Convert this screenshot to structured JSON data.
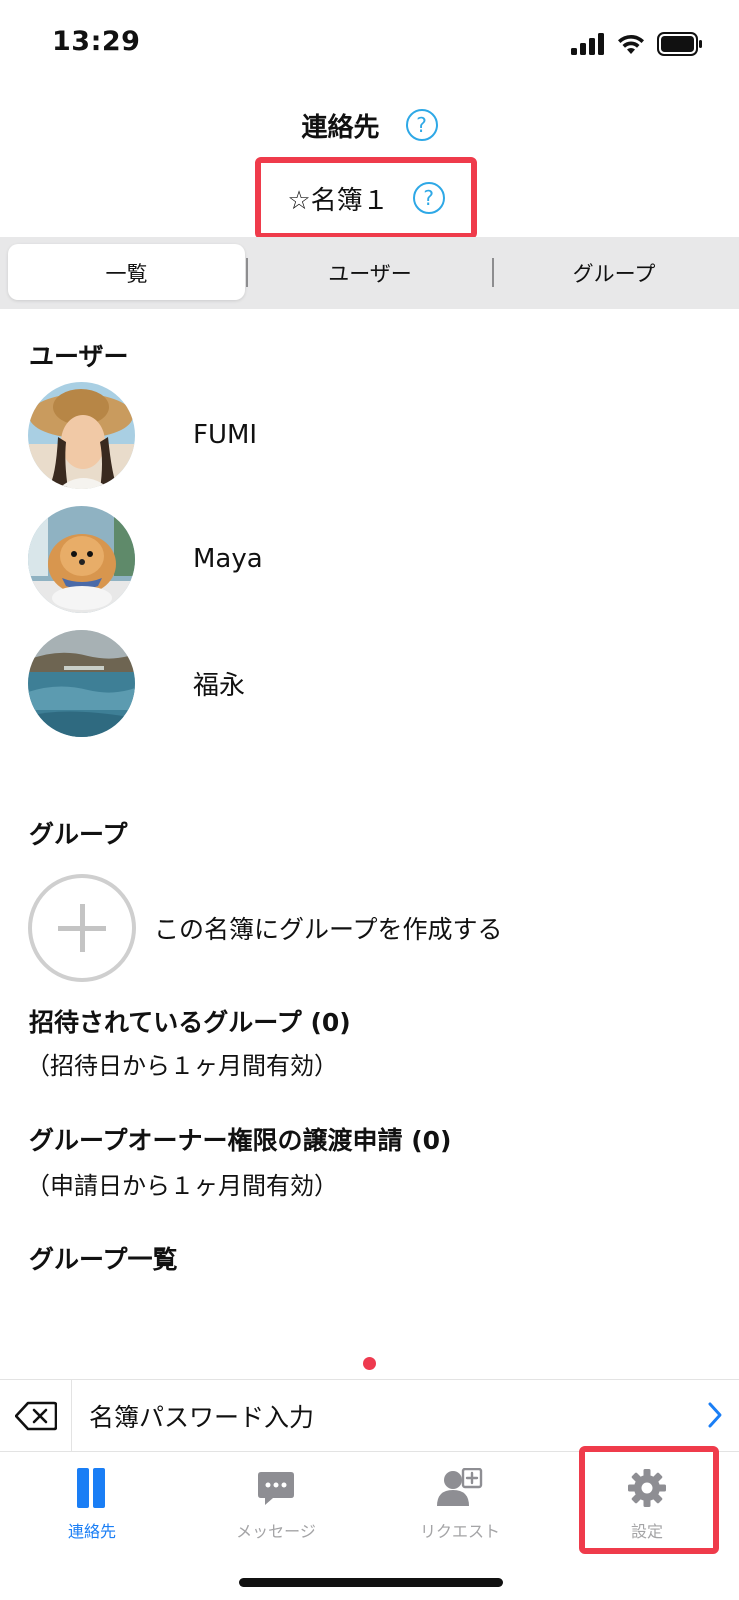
{
  "status_bar": {
    "time": "13:29"
  },
  "header": {
    "title": "連絡先"
  },
  "address_book": {
    "name": "☆名簿１"
  },
  "segments": [
    {
      "label": "一覧",
      "selected": true
    },
    {
      "label": "ユーザー",
      "selected": false
    },
    {
      "label": "グループ",
      "selected": false
    }
  ],
  "users_section": {
    "title": "ユーザー",
    "users": [
      {
        "name": "FUMI"
      },
      {
        "name": "Maya"
      },
      {
        "name": "福永"
      }
    ]
  },
  "groups_section": {
    "title": "グループ",
    "create_label": "この名簿にグループを作成する",
    "invited_title": "招待されているグループ (0)",
    "invited_note": "（招待日から１ヶ月間有効）",
    "transfer_title": "グループオーナー権限の譲渡申請 (0)",
    "transfer_note": "（申請日から１ヶ月間有効）",
    "list_title": "グループ一覧"
  },
  "password_bar": {
    "label": "名簿パスワード入力"
  },
  "tab_bar": {
    "tabs": [
      {
        "label": "連絡先",
        "icon": "contacts-icon",
        "active": true
      },
      {
        "label": "メッセージ",
        "icon": "message-icon",
        "active": false
      },
      {
        "label": "リクエスト",
        "icon": "request-icon",
        "active": false
      },
      {
        "label": "設定",
        "icon": "gear-icon",
        "active": false
      }
    ]
  },
  "colors": {
    "accent_blue": "#1a7ef5",
    "help_blue": "#2ea8e6",
    "highlight_red": "#ef3b4b",
    "inactive_gray": "#a4a4a6",
    "segment_bg": "#e8e8e9"
  }
}
